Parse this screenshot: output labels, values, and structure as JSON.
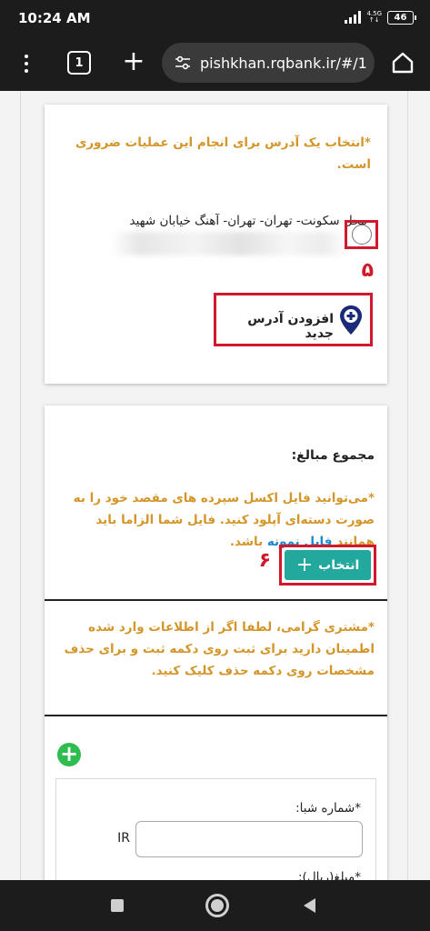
{
  "status_bar": {
    "time": "10:24 AM",
    "network_top": "4.5G",
    "network_bottom": "↑↓",
    "battery": "46"
  },
  "browser": {
    "tab_count": "1",
    "url": "pishkhan.rqbank.ir/#/1",
    "icons": [
      "more-vert-icon",
      "tabs-icon",
      "plus-icon",
      "site-settings-icon",
      "home-icon"
    ]
  },
  "address_card": {
    "required_note": "*انتخاب یک آدرس برای انجام این عملیات ضروری است.",
    "address_line": "محل سکونت- تهران- تهران- آهنگ خیابان شهید",
    "step_number": "۵",
    "add_address_label": "افزودن آدرس جدید"
  },
  "amounts_card": {
    "title": "مجموع مبالغ:",
    "excel_note": "*می‌توانید فایل اکسل سپرده های مقصد خود را به صورت دسته‌ای آپلود کنید. فایل شما الزاما باید همانند",
    "sample_link": "فایل نمونه",
    "excel_note_end": "باشد.",
    "select_label": "انتخاب",
    "step_number": "۶",
    "confirm_note": "*مشتری گرامی، لطفا اگر از اطلاعات وارد شده اطمینان دارید برای ثبت روی دکمه ثبت و برای حذف مشخصات روی دکمه حذف کلیک کنید.",
    "add_symbol": "+",
    "form": {
      "sheba_label": "*شماره شبا:",
      "sheba_prefix": "IR",
      "amount_label": "*مبلغ(ریال):"
    }
  },
  "colors": {
    "warning": "#d4962a",
    "highlight": "#d1192b",
    "primary_button": "#22a89d",
    "link": "#1e88c9",
    "add_green": "#2ebd4f",
    "pin": "#1b2a78"
  }
}
